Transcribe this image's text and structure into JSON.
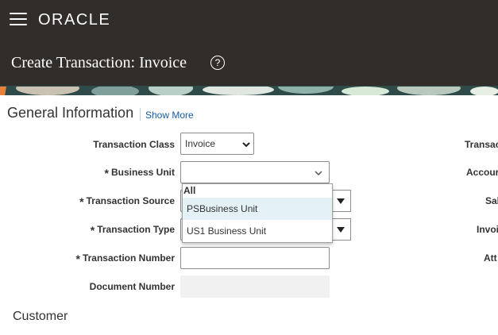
{
  "header": {
    "brand": "ORACLE",
    "page_title": "Create Transaction: Invoice",
    "help_glyph": "?"
  },
  "section": {
    "title": "General Information",
    "show_more": "Show More"
  },
  "fields": {
    "transaction_class": {
      "label": "Transaction Class",
      "value": "Invoice"
    },
    "business_unit": {
      "label": "Business Unit",
      "value": ""
    },
    "transaction_source": {
      "label": "Transaction Source"
    },
    "transaction_type": {
      "label": "Transaction Type"
    },
    "transaction_number": {
      "label": "Transaction Number",
      "value": ""
    },
    "document_number": {
      "label": "Document Number",
      "value": ""
    }
  },
  "required_mark": "*",
  "right_labels": [
    "Transac",
    "Accour",
    "Sal",
    "Invoi",
    "Att"
  ],
  "dropdown": {
    "header": "All",
    "items": [
      "PSBusiness Unit",
      "US1 Business Unit"
    ],
    "highlighted_index": 0
  },
  "customer_title": "Customer",
  "colors": {
    "header_bg": "#312d2a",
    "link": "#145c9e",
    "highlight": "#e4f1f7"
  }
}
